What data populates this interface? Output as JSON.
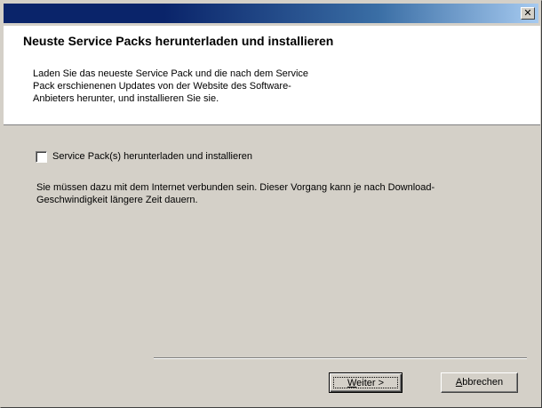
{
  "window": {
    "close_glyph": "✕"
  },
  "header": {
    "title": "Neuste Service Packs herunterladen und installieren",
    "description": "Laden Sie das neueste Service Pack und die nach dem Service Pack erschienenen Updates von der Website des Software-Anbieters herunter, und installieren Sie sie."
  },
  "options": {
    "download_checkbox": {
      "label": "Service Pack(s) herunterladen und installieren",
      "checked": false
    }
  },
  "note": "Sie müssen dazu mit dem Internet verbunden sein. Dieser Vorgang kann je nach Download-Geschwindigkeit längere Zeit dauern.",
  "buttons": {
    "next": {
      "mnemonic": "W",
      "rest": "eiter >"
    },
    "cancel": {
      "mnemonic": "A",
      "rest": "bbrechen"
    }
  }
}
